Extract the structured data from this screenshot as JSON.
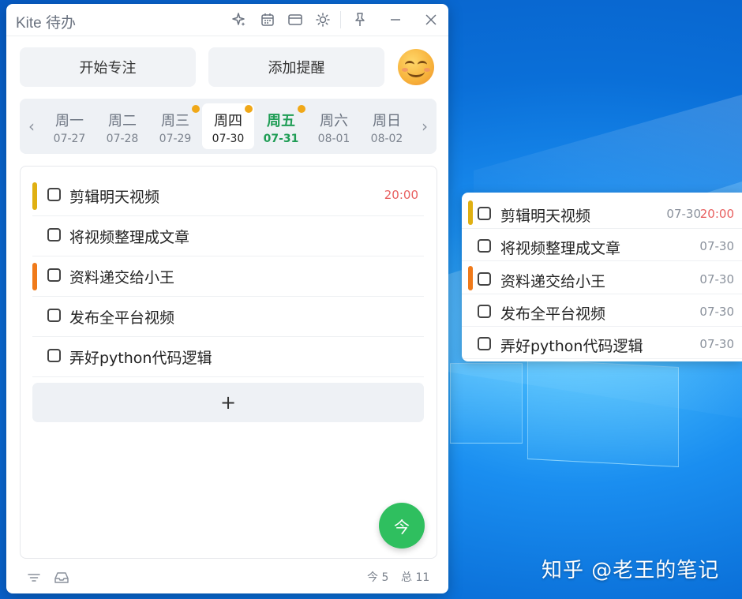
{
  "app": {
    "title": "Kite 待办"
  },
  "actions": {
    "focus_label": "开始专注",
    "reminder_label": "添加提醒"
  },
  "week": [
    {
      "name": "周一",
      "date": "07-27",
      "selected": false,
      "today": false,
      "dot": false
    },
    {
      "name": "周二",
      "date": "07-28",
      "selected": false,
      "today": false,
      "dot": false
    },
    {
      "name": "周三",
      "date": "07-29",
      "selected": false,
      "today": false,
      "dot": true
    },
    {
      "name": "周四",
      "date": "07-30",
      "selected": true,
      "today": false,
      "dot": true
    },
    {
      "name": "周五",
      "date": "07-31",
      "selected": false,
      "today": true,
      "dot": true
    },
    {
      "name": "周六",
      "date": "08-01",
      "selected": false,
      "today": false,
      "dot": false
    },
    {
      "name": "周日",
      "date": "08-02",
      "selected": false,
      "today": false,
      "dot": false
    }
  ],
  "tasks": [
    {
      "text": "剪辑明天视频",
      "time": "20:00",
      "priority_color": "#e0b012"
    },
    {
      "text": "将视频整理成文章",
      "time": "",
      "priority_color": ""
    },
    {
      "text": "资料递交给小王",
      "time": "",
      "priority_color": "#f07a1a"
    },
    {
      "text": "发布全平台视频",
      "time": "",
      "priority_color": ""
    },
    {
      "text": "弄好python代码逻辑",
      "time": "",
      "priority_color": ""
    }
  ],
  "add_label": "+",
  "fab_label": "今",
  "footer": {
    "today_count": "今 5",
    "total_count": "总 11"
  },
  "widget": {
    "rows": [
      {
        "text": "剪辑明天视频",
        "date": "07-30",
        "time": "20:00",
        "priority_color": "#e0b012"
      },
      {
        "text": "将视频整理成文章",
        "date": "07-30",
        "time": "",
        "priority_color": ""
      },
      {
        "text": "资料递交给小王",
        "date": "07-30",
        "time": "",
        "priority_color": "#f07a1a"
      },
      {
        "text": "发布全平台视频",
        "date": "07-30",
        "time": "",
        "priority_color": ""
      },
      {
        "text": "弄好python代码逻辑",
        "date": "07-30",
        "time": "",
        "priority_color": ""
      }
    ]
  },
  "watermark": "知乎 @老王的笔记",
  "colors": {
    "accent_green": "#2fbf5f",
    "today_green": "#1f9d55",
    "time_red": "#e86060",
    "dot_orange": "#f0a818"
  }
}
